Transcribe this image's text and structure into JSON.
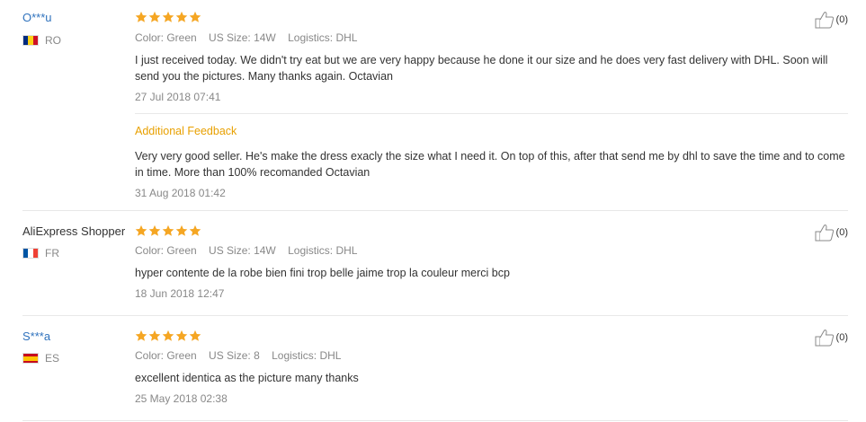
{
  "reviews": [
    {
      "user": "O***u",
      "country": "RO",
      "color": "Color: Green",
      "size": "US Size: 14W",
      "logistics": "Logistics: DHL",
      "text": "I just received today. We didn't try eat but we are very happy because he done it our size and he does very fast delivery with DHL. Soon will send you the pictures. Many thanks again. Octavian",
      "date": "27 Jul 2018 07:41",
      "likes": "(0)",
      "additional": {
        "label": "Additional Feedback",
        "text": "Very very good seller. He's make the dress exacly the size what I need it. On top of this, after that send me by dhl to save the time and to come in time. More than 100% recomanded Octavian",
        "date": "31 Aug 2018 01:42"
      }
    },
    {
      "user": "AliExpress Shopper",
      "country": "FR",
      "color": "Color: Green",
      "size": "US Size: 14W",
      "logistics": "Logistics: DHL",
      "text": "hyper contente de la robe bien fini trop belle jaime trop la couleur merci bcp",
      "date": "18 Jun 2018 12:47",
      "likes": "(0)"
    },
    {
      "user": "S***a",
      "country": "ES",
      "color": "Color: Green",
      "size": "US Size: 8",
      "logistics": "Logistics: DHL",
      "text": "excellent identica as the picture many thanks",
      "date": "25 May 2018 02:38",
      "likes": "(0)"
    }
  ],
  "rating_stars": 5,
  "colors": {
    "star": "#f5a623",
    "link": "#2f72bd",
    "additional": "#e8a000"
  },
  "icons": {
    "rating": "star-icon",
    "like": "thumbs-up-icon"
  }
}
